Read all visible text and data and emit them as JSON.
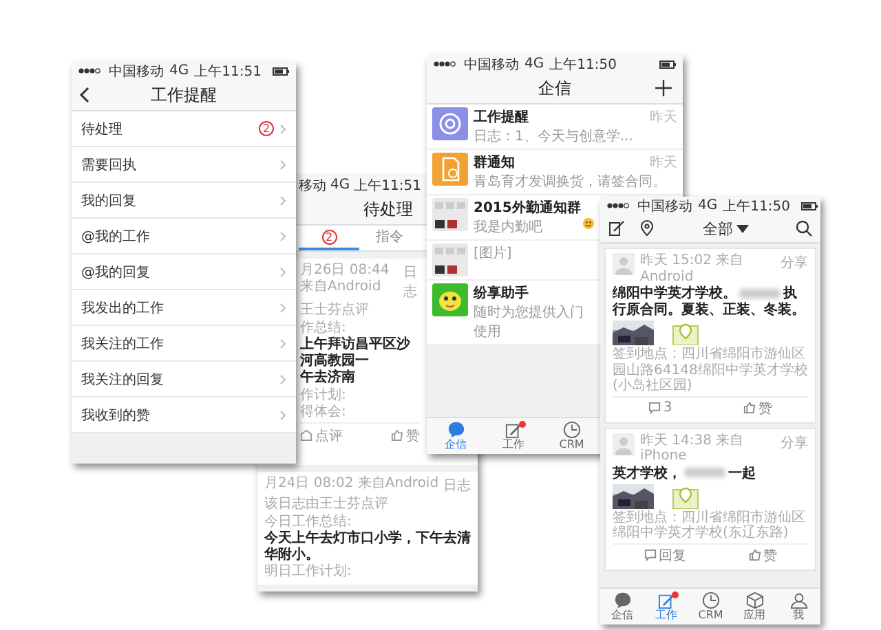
{
  "phones": [
    {
      "kind": "menu",
      "status": {
        "carrier": "中国移动",
        "network": "4G",
        "time": "上午11:51"
      },
      "title": "工作提醒",
      "items": [
        {
          "label": "待处理",
          "badge": "2"
        },
        {
          "label": "需要回执"
        },
        {
          "label": "我的回复"
        },
        {
          "label": "@我的工作"
        },
        {
          "label": "@我的回复"
        },
        {
          "label": "我发出的工作"
        },
        {
          "label": "我关注的工作"
        },
        {
          "label": "我关注的回复"
        },
        {
          "label": "我收到的赞"
        }
      ]
    },
    {
      "kind": "inbox",
      "status": {
        "carrier": "移动",
        "network": "4G",
        "time": "上午11:51"
      },
      "title": "待处理",
      "tabs": [
        {
          "badge": "2",
          "selected": true
        },
        {
          "label": "指令",
          "selected": false
        }
      ],
      "cards": [
        {
          "tag": "日志",
          "meta": "月26日 08:44 来自Android",
          "note": "王士芬点评",
          "lines": [
            {
              "kind": "label",
              "text": "作总结:"
            },
            {
              "kind": "body",
              "text": "上午拜访昌平区沙河高教园一"
            },
            {
              "kind": "body",
              "text": "午去济南"
            },
            {
              "kind": "label",
              "text": "作计划:"
            },
            {
              "kind": "label",
              "text": "得体会:"
            }
          ],
          "actions": [
            {
              "kind": "review",
              "label": "点评"
            },
            {
              "kind": "like",
              "label": "赞"
            }
          ]
        },
        {
          "tag": "日志",
          "meta": "月24日 08:02 来自Android",
          "note": "该日志由王士芬点评",
          "lines": [
            {
              "kind": "label",
              "text": "今日工作总结:"
            },
            {
              "kind": "body",
              "text": "今天上午去灯市口小学，下午去清华附小。"
            },
            {
              "kind": "label",
              "text": "明日工作计划:"
            }
          ]
        }
      ]
    },
    {
      "kind": "messages",
      "status": {
        "carrier": "中国移动",
        "network": "4G",
        "time": "上午11:50"
      },
      "title": "企信",
      "chats": [
        {
          "kind": "reminder",
          "name": "工作提醒",
          "time": "昨天",
          "preview": "日志：1、今天与创意学...",
          "emoji": false
        },
        {
          "kind": "notice",
          "name": "群通知",
          "time": "昨天",
          "preview": "青岛育才发调换货，请签合同。",
          "emoji": false
        },
        {
          "kind": "group",
          "name": "2015外勤通知群",
          "preview": "我是内勤吧",
          "emoji": true
        },
        {
          "kind": "group",
          "preview": "[图片]",
          "emoji": false
        },
        {
          "kind": "assistant",
          "name": "纷享助手",
          "preview": "随时为您提供入门使用",
          "emoji": false
        }
      ],
      "tabs": [
        {
          "kind": "chat",
          "label": "企信",
          "selected": true,
          "dot": false
        },
        {
          "kind": "work",
          "label": "工作",
          "selected": false,
          "dot": true
        },
        {
          "kind": "crm",
          "label": "CRM",
          "selected": false,
          "dot": false
        }
      ]
    },
    {
      "kind": "feed",
      "status": {
        "carrier": "中国移动",
        "network": "4G",
        "time": "上午11:50"
      },
      "filter": "全部",
      "posts": [
        {
          "tag": "分享",
          "meta": "昨天 15:02 来自Android",
          "text": [
            "绵阳中学英才学校。",
            "执行原合同。夏装、正装、冬装。"
          ],
          "location": "签到地点：四川省绵阳市游仙区园山路64148绵阳中学英才学校(小岛社区园)",
          "actions": [
            {
              "kind": "comment",
              "label": "3"
            },
            {
              "kind": "like",
              "label": "赞"
            }
          ]
        },
        {
          "tag": "分享",
          "meta": "昨天 14:38 来自iPhone",
          "text": [
            "英才学校，",
            "一起"
          ],
          "location": "签到地点：四川省绵阳市游仙区绵阳中学英才学校(东辽东路)",
          "actions": [
            {
              "kind": "comment",
              "label": "回复"
            },
            {
              "kind": "like",
              "label": "赞"
            }
          ]
        }
      ],
      "tabs": [
        {
          "kind": "chat",
          "label": "企信",
          "selected": false,
          "dot": false
        },
        {
          "kind": "work",
          "label": "工作",
          "selected": true,
          "dot": true
        },
        {
          "kind": "crm",
          "label": "CRM",
          "selected": false,
          "dot": false
        },
        {
          "kind": "apps",
          "label": "应用",
          "selected": false,
          "dot": false
        },
        {
          "kind": "me",
          "label": "我",
          "selected": false,
          "dot": false
        }
      ]
    }
  ]
}
